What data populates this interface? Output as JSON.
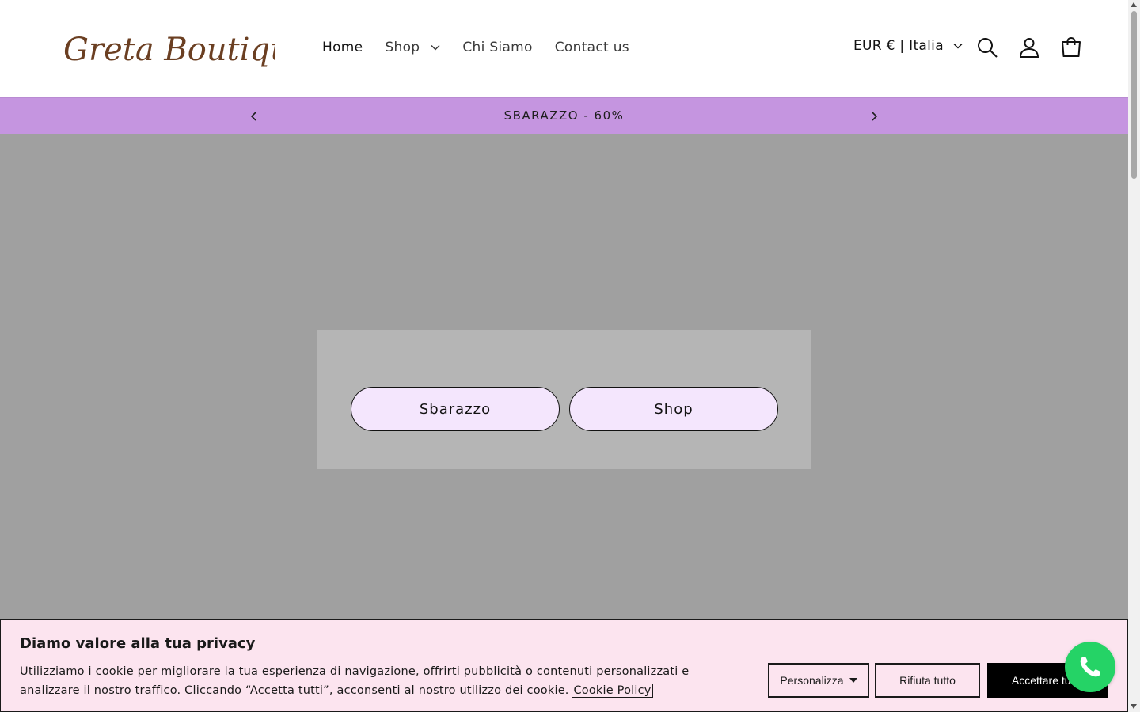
{
  "header": {
    "logo_text": "Greta Boutique",
    "nav": [
      {
        "label": "Home",
        "active": true
      },
      {
        "label": "Shop",
        "has_dropdown": true
      },
      {
        "label": "Chi Siamo"
      },
      {
        "label": "Contact us"
      }
    ],
    "locale": "EUR € | Italia",
    "icons": [
      "search-icon",
      "account-icon",
      "cart-icon"
    ]
  },
  "announcement": {
    "text": "SBARAZZO - 60%",
    "background": "#c595e0"
  },
  "hero": {
    "background": "#a0a0a0",
    "buttons": [
      "Sbarazzo",
      "Shop"
    ],
    "button_color": "#f4e6fd"
  },
  "cookie": {
    "title": "Diamo valore alla tua privacy",
    "text": "Utilizziamo i cookie per migliorare la tua esperienza di navigazione, offrirti pubblicità o contenuti personalizzati e analizzare il nostro traffico. Cliccando “Accetta tutti”, acconsenti al nostro utilizzo dei cookie.",
    "link": "Cookie Policy",
    "customize_label": "Personalizza",
    "reject_label": "Rifiuta tutto",
    "accept_label": "Accettare tutto",
    "background": "#fce4ef"
  },
  "widgets": {
    "whatsapp_icon": "whatsapp-icon",
    "whatsapp_color": "#25d366"
  }
}
